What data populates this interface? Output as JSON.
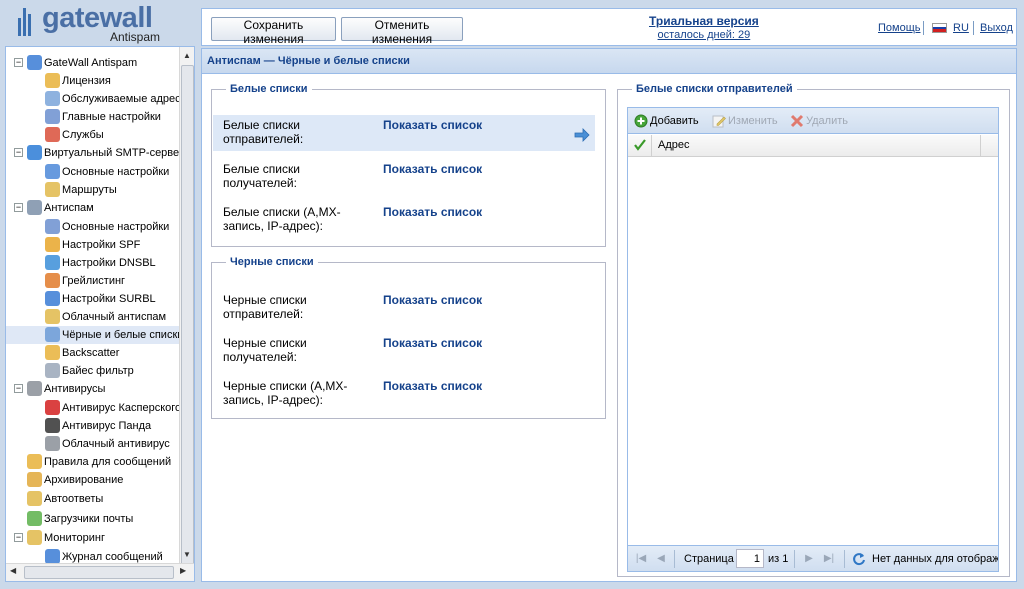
{
  "logo": {
    "brand": "gatewall",
    "subtitle": "Antispam"
  },
  "toolbar": {
    "save_label": "Сохранить изменения",
    "cancel_label": "Отменить изменения",
    "trial_title": "Триальная версия",
    "trial_days": "осталось дней: 29",
    "help_label": "Помощь",
    "lang_label": "RU",
    "logout_label": "Выход"
  },
  "sidebar": {
    "items": [
      {
        "label": "GateWall Antispam",
        "icon": "gatewall-icon"
      },
      {
        "label": "Лицензия",
        "icon": "license-icon"
      },
      {
        "label": "Обслуживаемые адреса",
        "icon": "mail-icon"
      },
      {
        "label": "Главные настройки",
        "icon": "settings-mail-icon"
      },
      {
        "label": "Службы",
        "icon": "services-icon"
      },
      {
        "label": "Виртуальный SMTP-сервер",
        "icon": "at-icon"
      },
      {
        "label": "Основные настройки",
        "icon": "at-settings-icon"
      },
      {
        "label": "Маршруты",
        "icon": "route-icon"
      },
      {
        "label": "Антиспам",
        "icon": "antispam-icon"
      },
      {
        "label": "Основные настройки",
        "icon": "settings-mail-icon"
      },
      {
        "label": "Настройки SPF",
        "icon": "spf-icon"
      },
      {
        "label": "Настройки DNSBL",
        "icon": "dnsbl-icon"
      },
      {
        "label": "Грейлистинг",
        "icon": "greylist-icon"
      },
      {
        "label": "Настройки SURBL",
        "icon": "surbl-icon"
      },
      {
        "label": "Облачный антиспам",
        "icon": "cloud-mail-icon"
      },
      {
        "label": "Чёрные и белые списки",
        "icon": "lists-icon"
      },
      {
        "label": "Backscatter",
        "icon": "backscatter-icon"
      },
      {
        "label": "Байес фильтр",
        "icon": "bayes-icon"
      },
      {
        "label": "Антивирусы",
        "icon": "antivirus-icon"
      },
      {
        "label": "Антивирус Касперского",
        "icon": "kaspersky-icon"
      },
      {
        "label": "Антивирус Панда",
        "icon": "panda-icon"
      },
      {
        "label": "Облачный антивирус",
        "icon": "cloud-virus-icon"
      },
      {
        "label": "Правила для сообщений",
        "icon": "rules-icon"
      },
      {
        "label": "Архивирование",
        "icon": "archive-icon"
      },
      {
        "label": "Автоответы",
        "icon": "autoreply-icon"
      },
      {
        "label": "Загрузчики почты",
        "icon": "downloader-icon"
      },
      {
        "label": "Мониторинг",
        "icon": "monitoring-icon"
      },
      {
        "label": "Журнал сообщений",
        "icon": "log-icon"
      }
    ],
    "selected_index": 15
  },
  "main": {
    "title": "Антиспам — Чёрные и белые списки",
    "white": {
      "legend": "Белые списки",
      "rows": [
        {
          "label": "Белые списки отправителей:",
          "link": "Показать список"
        },
        {
          "label": "Белые списки получателей:",
          "link": "Показать список"
        },
        {
          "label": "Белые списки (A,MX-запись, IP-адрес):",
          "link": "Показать список"
        }
      ]
    },
    "black": {
      "legend": "Черные списки",
      "rows": [
        {
          "label": "Черные списки отправителей:",
          "link": "Показать список"
        },
        {
          "label": "Черные списки получателей:",
          "link": "Показать список"
        },
        {
          "label": "Черные списки (A,MX-запись, IP-адрес):",
          "link": "Показать список"
        }
      ]
    },
    "senders": {
      "legend": "Белые списки отправителей",
      "add_label": "Добавить",
      "edit_label": "Изменить",
      "delete_label": "Удалить",
      "column": "Адрес",
      "page_label": "Страница",
      "page_value": "1",
      "of_label": "из 1",
      "empty_label": "Нет данных для отображения"
    }
  },
  "colors": {
    "accent": "#15428b",
    "panel_border": "#99bbe8",
    "background": "#cbd9ea",
    "selected_row": "#dde8f7"
  }
}
